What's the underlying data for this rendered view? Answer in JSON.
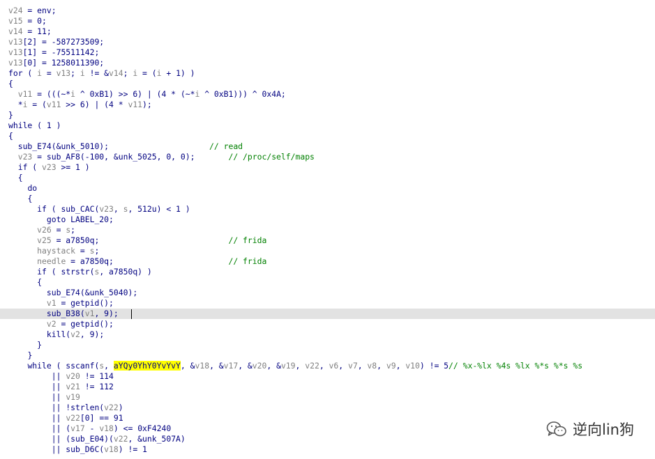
{
  "watermark": {
    "text": "逆向lin狗",
    "icon": "wechat-icon"
  },
  "colors": {
    "code": "#000080",
    "variable": "#808080",
    "comment": "#008000",
    "highlight": "#ffff00",
    "current_line": "#e2e2e2"
  },
  "lines": [
    {
      "indent": 0,
      "segments": [
        [
          "var",
          "v24"
        ],
        [
          "code",
          " = env;"
        ]
      ]
    },
    {
      "indent": 0,
      "segments": [
        [
          "var",
          "v15"
        ],
        [
          "code",
          " = 0;"
        ]
      ]
    },
    {
      "indent": 0,
      "segments": [
        [
          "var",
          "v14"
        ],
        [
          "code",
          " = 11;"
        ]
      ]
    },
    {
      "indent": 0,
      "segments": [
        [
          "var",
          "v13"
        ],
        [
          "code",
          "[2] = -587273509;"
        ]
      ]
    },
    {
      "indent": 0,
      "segments": [
        [
          "var",
          "v13"
        ],
        [
          "code",
          "[1] = -75511142;"
        ]
      ]
    },
    {
      "indent": 0,
      "segments": [
        [
          "var",
          "v13"
        ],
        [
          "code",
          "[0] = 1258011390;"
        ]
      ]
    },
    {
      "indent": 0,
      "segments": [
        [
          "code",
          "for ( "
        ],
        [
          "var",
          "i"
        ],
        [
          "code",
          " = "
        ],
        [
          "var",
          "v13"
        ],
        [
          "code",
          "; "
        ],
        [
          "var",
          "i"
        ],
        [
          "code",
          " != &"
        ],
        [
          "var",
          "v14"
        ],
        [
          "code",
          "; "
        ],
        [
          "var",
          "i"
        ],
        [
          "code",
          " = ("
        ],
        [
          "var",
          "i"
        ],
        [
          "code",
          " + 1) )"
        ]
      ]
    },
    {
      "indent": 0,
      "segments": [
        [
          "code",
          "{"
        ]
      ]
    },
    {
      "indent": 1,
      "segments": [
        [
          "var",
          "v11"
        ],
        [
          "code",
          " = (((~*"
        ],
        [
          "var",
          "i"
        ],
        [
          "code",
          " ^ 0xB1) >> 6) | (4 * (~*"
        ],
        [
          "var",
          "i"
        ],
        [
          "code",
          " ^ 0xB1))) ^ 0x4A;"
        ]
      ]
    },
    {
      "indent": 1,
      "segments": [
        [
          "code",
          "*"
        ],
        [
          "var",
          "i"
        ],
        [
          "code",
          " = ("
        ],
        [
          "var",
          "v11"
        ],
        [
          "code",
          " >> 6) | (4 * "
        ],
        [
          "var",
          "v11"
        ],
        [
          "code",
          ");"
        ]
      ]
    },
    {
      "indent": 0,
      "segments": [
        [
          "code",
          "}"
        ]
      ]
    },
    {
      "indent": 0,
      "segments": [
        [
          "code",
          "while ( 1 )"
        ]
      ]
    },
    {
      "indent": 0,
      "segments": [
        [
          "code",
          "{"
        ]
      ]
    },
    {
      "indent": 1,
      "segments": [
        [
          "code",
          "sub_E74(&unk_5010);                     "
        ],
        [
          "cmt",
          "// read"
        ]
      ]
    },
    {
      "indent": 1,
      "segments": [
        [
          "var",
          "v23"
        ],
        [
          "code",
          " = sub_AF8(-100, &unk_5025, 0, 0);       "
        ],
        [
          "cmt",
          "// /proc/self/maps"
        ]
      ]
    },
    {
      "indent": 1,
      "segments": [
        [
          "code",
          "if ( "
        ],
        [
          "var",
          "v23"
        ],
        [
          "code",
          " >= 1 )"
        ]
      ]
    },
    {
      "indent": 1,
      "segments": [
        [
          "code",
          "{"
        ]
      ]
    },
    {
      "indent": 2,
      "segments": [
        [
          "code",
          "do"
        ]
      ]
    },
    {
      "indent": 2,
      "segments": [
        [
          "code",
          "{"
        ]
      ]
    },
    {
      "indent": 3,
      "segments": [
        [
          "code",
          "if ( sub_CAC("
        ],
        [
          "var",
          "v23"
        ],
        [
          "code",
          ", "
        ],
        [
          "var",
          "s"
        ],
        [
          "code",
          ", 512u) < 1 )"
        ]
      ]
    },
    {
      "indent": 4,
      "segments": [
        [
          "code",
          "goto LABEL_20;"
        ]
      ]
    },
    {
      "indent": 3,
      "segments": [
        [
          "var",
          "v26"
        ],
        [
          "code",
          " = "
        ],
        [
          "var",
          "s"
        ],
        [
          "code",
          ";"
        ]
      ]
    },
    {
      "indent": 3,
      "segments": [
        [
          "var",
          "v25"
        ],
        [
          "code",
          " = a7850q;                           "
        ],
        [
          "cmt",
          "// frida"
        ]
      ]
    },
    {
      "indent": 3,
      "segments": [
        [
          "var",
          "haystack"
        ],
        [
          "code",
          " = "
        ],
        [
          "var",
          "s"
        ],
        [
          "code",
          ";"
        ]
      ]
    },
    {
      "indent": 3,
      "segments": [
        [
          "var",
          "needle"
        ],
        [
          "code",
          " = a7850q;                        "
        ],
        [
          "cmt",
          "// frida"
        ]
      ]
    },
    {
      "indent": 3,
      "segments": [
        [
          "code",
          "if ( strstr("
        ],
        [
          "var",
          "s"
        ],
        [
          "code",
          ", a7850q) )"
        ]
      ]
    },
    {
      "indent": 3,
      "segments": [
        [
          "code",
          "{"
        ]
      ]
    },
    {
      "indent": 4,
      "segments": [
        [
          "code",
          "sub_E74(&unk_5040);"
        ]
      ]
    },
    {
      "indent": 4,
      "segments": [
        [
          "var",
          "v1"
        ],
        [
          "code",
          " = getpid();"
        ]
      ]
    },
    {
      "indent": 4,
      "current": true,
      "segments": [
        [
          "code",
          "sub_B38("
        ],
        [
          "var",
          "v1"
        ],
        [
          "code",
          ", 9);"
        ]
      ]
    },
    {
      "indent": 4,
      "segments": [
        [
          "var",
          "v2"
        ],
        [
          "code",
          " = getpid();"
        ]
      ]
    },
    {
      "indent": 4,
      "segments": [
        [
          "code",
          "kill("
        ],
        [
          "var",
          "v2"
        ],
        [
          "code",
          ", 9);"
        ]
      ]
    },
    {
      "indent": 3,
      "segments": [
        [
          "code",
          "}"
        ]
      ]
    },
    {
      "indent": 2,
      "segments": [
        [
          "code",
          "}"
        ]
      ]
    },
    {
      "indent": 2,
      "segments": [
        [
          "code",
          "while ( sscanf("
        ],
        [
          "var",
          "s"
        ],
        [
          "code",
          ", "
        ],
        [
          "hl",
          "aYQy0YhY0YvYvY"
        ],
        [
          "code",
          ", &"
        ],
        [
          "var",
          "v18"
        ],
        [
          "code",
          ", &"
        ],
        [
          "var",
          "v17"
        ],
        [
          "code",
          ", &"
        ],
        [
          "var",
          "v20"
        ],
        [
          "code",
          ", &"
        ],
        [
          "var",
          "v19"
        ],
        [
          "code",
          ", "
        ],
        [
          "var",
          "v22"
        ],
        [
          "code",
          ", "
        ],
        [
          "var",
          "v6"
        ],
        [
          "code",
          ", "
        ],
        [
          "var",
          "v7"
        ],
        [
          "code",
          ", "
        ],
        [
          "var",
          "v8"
        ],
        [
          "code",
          ", "
        ],
        [
          "var",
          "v9"
        ],
        [
          "code",
          ", "
        ],
        [
          "var",
          "v10"
        ],
        [
          "code",
          ") != 5"
        ],
        [
          "cmt",
          "// %x-%lx %4s %lx %*s %*s %s"
        ]
      ]
    },
    {
      "indent": 0,
      "prefix": "         ",
      "segments": [
        [
          "code",
          "|| "
        ],
        [
          "var",
          "v20"
        ],
        [
          "code",
          " != 114"
        ]
      ]
    },
    {
      "indent": 0,
      "prefix": "         ",
      "segments": [
        [
          "code",
          "|| "
        ],
        [
          "var",
          "v21"
        ],
        [
          "code",
          " != 112"
        ]
      ]
    },
    {
      "indent": 0,
      "prefix": "         ",
      "segments": [
        [
          "code",
          "|| "
        ],
        [
          "var",
          "v19"
        ]
      ]
    },
    {
      "indent": 0,
      "prefix": "         ",
      "segments": [
        [
          "code",
          "|| !strlen("
        ],
        [
          "var",
          "v22"
        ],
        [
          "code",
          ")"
        ]
      ]
    },
    {
      "indent": 0,
      "prefix": "         ",
      "segments": [
        [
          "code",
          "|| "
        ],
        [
          "var",
          "v22"
        ],
        [
          "code",
          "[0] == 91"
        ]
      ]
    },
    {
      "indent": 0,
      "prefix": "         ",
      "segments": [
        [
          "code",
          "|| ("
        ],
        [
          "var",
          "v17"
        ],
        [
          "code",
          " - "
        ],
        [
          "var",
          "v18"
        ],
        [
          "code",
          ") <= 0xF4240"
        ]
      ]
    },
    {
      "indent": 0,
      "prefix": "         ",
      "segments": [
        [
          "code",
          "|| (sub_E04)("
        ],
        [
          "var",
          "v22"
        ],
        [
          "code",
          ", &unk_507A)"
        ]
      ]
    },
    {
      "indent": 0,
      "prefix": "         ",
      "segments": [
        [
          "code",
          "|| sub_D6C("
        ],
        [
          "var",
          "v18"
        ],
        [
          "code",
          ") != 1"
        ]
      ]
    }
  ]
}
